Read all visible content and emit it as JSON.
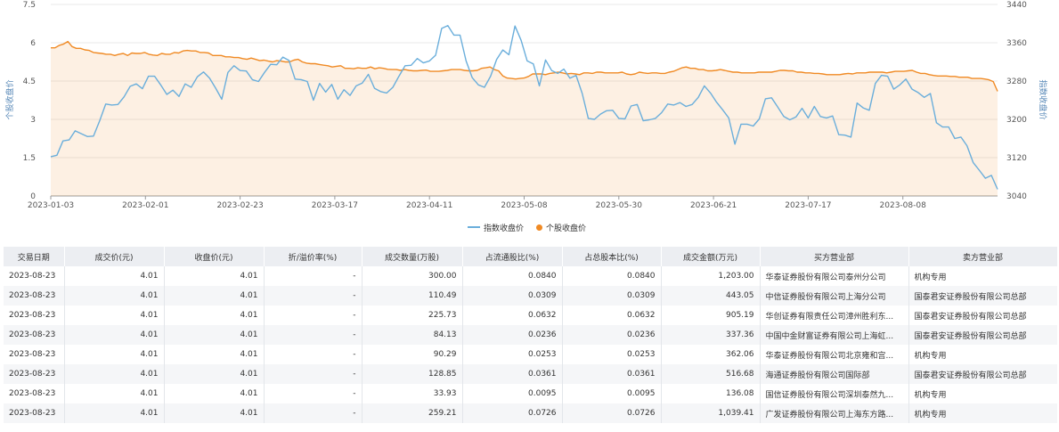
{
  "chart_data": {
    "type": "line",
    "left_axis": {
      "label": "个股收盘价",
      "ticks": [
        "0",
        "1.5",
        "3",
        "4.5",
        "6",
        "7.5"
      ],
      "range": [
        0,
        7.5
      ]
    },
    "right_axis": {
      "label": "指数收盘价",
      "ticks": [
        "3040",
        "3120",
        "3200",
        "3280",
        "3360",
        "3440"
      ],
      "range": [
        3040,
        3440
      ]
    },
    "x_ticks": [
      "2023-01-03",
      "2023-02-01",
      "2023-02-23",
      "2023-03-17",
      "2023-04-11",
      "2023-05-08",
      "2023-05-30",
      "2023-06-21",
      "2023-07-17",
      "2023-08-08"
    ],
    "series": [
      {
        "name": "指数收盘价",
        "axis": "right",
        "color": "#6aaedb",
        "fill": false,
        "values": [
          3122,
          3125,
          3155,
          3157,
          3176,
          3170,
          3164,
          3165,
          3197,
          3232,
          3230,
          3231,
          3247,
          3269,
          3274,
          3264,
          3290,
          3290,
          3272,
          3252,
          3261,
          3248,
          3274,
          3267,
          3289,
          3299,
          3286,
          3265,
          3242,
          3298,
          3312,
          3302,
          3301,
          3283,
          3279,
          3298,
          3315,
          3314,
          3330,
          3323,
          3284,
          3283,
          3279,
          3240,
          3275,
          3257,
          3273,
          3242,
          3262,
          3250,
          3270,
          3276,
          3294,
          3265,
          3258,
          3255,
          3267,
          3290,
          3312,
          3313,
          3327,
          3318,
          3322,
          3334,
          3390,
          3396,
          3376,
          3376,
          3322,
          3287,
          3272,
          3267,
          3290,
          3325,
          3345,
          3335,
          3395,
          3365,
          3322,
          3316,
          3270,
          3324,
          3302,
          3296,
          3305,
          3286,
          3292,
          3254,
          3202,
          3200,
          3211,
          3218,
          3219,
          3202,
          3201,
          3228,
          3231,
          3197,
          3199,
          3202,
          3214,
          3232,
          3230,
          3235,
          3227,
          3231,
          3246,
          3270,
          3255,
          3236,
          3220,
          3203,
          3148,
          3190,
          3190,
          3186,
          3201,
          3243,
          3245,
          3226,
          3206,
          3199,
          3205,
          3223,
          3203,
          3227,
          3206,
          3203,
          3207,
          3168,
          3167,
          3163,
          3234,
          3224,
          3219,
          3275,
          3292,
          3290,
          3263,
          3272,
          3284,
          3263,
          3256,
          3246,
          3254,
          3193,
          3184,
          3184,
          3160,
          3163,
          3145,
          3110,
          3094,
          3077,
          3083,
          3054
        ]
      },
      {
        "name": "个股收盘价",
        "axis": "left",
        "color": "#f08a24",
        "fill": true,
        "values": [
          5.8,
          5.8,
          5.9,
          5.95,
          6.05,
          5.85,
          5.78,
          5.78,
          5.72,
          5.7,
          5.62,
          5.6,
          5.58,
          5.55,
          5.55,
          5.5,
          5.55,
          5.58,
          5.5,
          5.6,
          5.58,
          5.58,
          5.62,
          5.55,
          5.52,
          5.5,
          5.58,
          5.55,
          5.55,
          5.62,
          5.6,
          5.68,
          5.7,
          5.68,
          5.68,
          5.62,
          5.62,
          5.6,
          5.5,
          5.5,
          5.5,
          5.45,
          5.45,
          5.42,
          5.42,
          5.38,
          5.35,
          5.4,
          5.35,
          5.3,
          5.32,
          5.28,
          5.25,
          5.3,
          5.28,
          5.25,
          5.25,
          5.32,
          5.35,
          5.25,
          5.2,
          5.18,
          5.18,
          5.15,
          5.12,
          5.1,
          5.05,
          5.08,
          5.1,
          5.0,
          5.0,
          4.98,
          5.02,
          5.0,
          5.0,
          5.05,
          4.98,
          5.02,
          5.0,
          4.96,
          4.95,
          4.95,
          4.92,
          4.95,
          4.92,
          4.9,
          4.9,
          4.92,
          4.93,
          4.88,
          4.88,
          4.88,
          4.9,
          4.92,
          4.95,
          4.95,
          4.95,
          4.92,
          4.9,
          4.9,
          4.92,
          5.0,
          5.02,
          5.05,
          4.95,
          4.9,
          4.7,
          4.62,
          4.6,
          4.58,
          4.6,
          4.62,
          4.68,
          4.78,
          4.78,
          4.78,
          4.75,
          4.8,
          4.82,
          4.85,
          4.82,
          4.78,
          4.8,
          4.78,
          4.75,
          4.82,
          4.82,
          4.8,
          4.85,
          4.85,
          4.82,
          4.82,
          4.82,
          4.82,
          4.85,
          4.78,
          4.75,
          4.78,
          4.85,
          4.82,
          4.8,
          4.82,
          4.82,
          4.8,
          4.8,
          4.85,
          4.88,
          4.95,
          5.02,
          5.05,
          5.0,
          5.0,
          4.95,
          4.95,
          4.9,
          4.9,
          4.92,
          4.95,
          4.92,
          4.88,
          4.85,
          4.85,
          4.82,
          4.82,
          4.82,
          4.82,
          4.85,
          4.85,
          4.85,
          4.85,
          4.88,
          4.92,
          4.92,
          4.9,
          4.9,
          4.85,
          4.85,
          4.82,
          4.82,
          4.8,
          4.8,
          4.78,
          4.75,
          4.75,
          4.75,
          4.75,
          4.78,
          4.8,
          4.78,
          4.82,
          4.82,
          4.82,
          4.85,
          4.85,
          4.85,
          4.85,
          4.82,
          4.85,
          4.88,
          4.88,
          4.88,
          4.9,
          4.92,
          4.85,
          4.8,
          4.8,
          4.75,
          4.72,
          4.7,
          4.7,
          4.7,
          4.68,
          4.68,
          4.65,
          4.65,
          4.65,
          4.6,
          4.6,
          4.6,
          4.58,
          4.55,
          4.48,
          4.1
        ]
      }
    ],
    "legend": [
      {
        "name": "指数收盘价",
        "color": "#6aaedb",
        "marker": "line"
      },
      {
        "name": "个股收盘价",
        "color": "#f08a24",
        "marker": "dot"
      }
    ]
  },
  "table": {
    "headers": [
      "交易日期",
      "成交价(元)",
      "收盘价(元)",
      "折/溢价率(%)",
      "成交数量(万股)",
      "占流通股比(%)",
      "占总股本比(%)",
      "成交金额(万元)",
      "买方营业部",
      "卖方营业部"
    ],
    "rows": [
      [
        "2023-08-23",
        "4.01",
        "4.01",
        "-",
        "300.00",
        "0.0840",
        "0.0840",
        "1,203.00",
        "华泰证券股份有限公司泰州分公司",
        "机构专用"
      ],
      [
        "2023-08-23",
        "4.01",
        "4.01",
        "-",
        "110.49",
        "0.0309",
        "0.0309",
        "443.05",
        "中信证券股份有限公司上海分公司",
        "国泰君安证券股份有限公司总部"
      ],
      [
        "2023-08-23",
        "4.01",
        "4.01",
        "-",
        "225.73",
        "0.0632",
        "0.0632",
        "905.19",
        "华创证券有限责任公司漳州胜利东...",
        "国泰君安证券股份有限公司总部"
      ],
      [
        "2023-08-23",
        "4.01",
        "4.01",
        "-",
        "84.13",
        "0.0236",
        "0.0236",
        "337.36",
        "中国中金财富证券有限公司上海虹...",
        "国泰君安证券股份有限公司总部"
      ],
      [
        "2023-08-23",
        "4.01",
        "4.01",
        "-",
        "90.29",
        "0.0253",
        "0.0253",
        "362.06",
        "华泰证券股份有限公司北京雍和宫...",
        "机构专用"
      ],
      [
        "2023-08-23",
        "4.01",
        "4.01",
        "-",
        "128.85",
        "0.0361",
        "0.0361",
        "516.68",
        "海通证券股份有限公司国际部",
        "国泰君安证券股份有限公司总部"
      ],
      [
        "2023-08-23",
        "4.01",
        "4.01",
        "-",
        "33.93",
        "0.0095",
        "0.0095",
        "136.08",
        "国信证券股份有限公司深圳泰然九...",
        "机构专用"
      ],
      [
        "2023-08-23",
        "4.01",
        "4.01",
        "-",
        "259.21",
        "0.0726",
        "0.0726",
        "1,039.41",
        "广发证券股份有限公司上海东方路...",
        "机构专用"
      ]
    ]
  }
}
